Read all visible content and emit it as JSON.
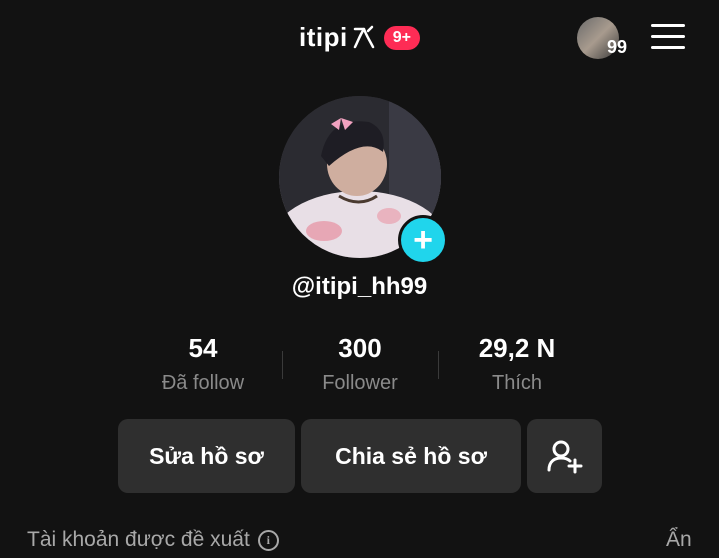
{
  "header": {
    "app_name": "itipi",
    "notification_badge": "9+",
    "top_avatar_count": "99"
  },
  "profile": {
    "username": "@itipi_hh99"
  },
  "stats": [
    {
      "value": "54",
      "label": "Đã follow"
    },
    {
      "value": "300",
      "label": "Follower"
    },
    {
      "value": "29,2 N",
      "label": "Thích"
    }
  ],
  "buttons": {
    "edit_profile": "Sửa hồ sơ",
    "share_profile": "Chia sẻ hồ sơ"
  },
  "suggested": {
    "label": "Tài khoản được đề xuất",
    "hide": "Ẩn"
  },
  "colors": {
    "background": "#121212",
    "badge": "#fe2c55",
    "add_button": "#20d5ec",
    "button_bg": "#2f2f2f"
  }
}
